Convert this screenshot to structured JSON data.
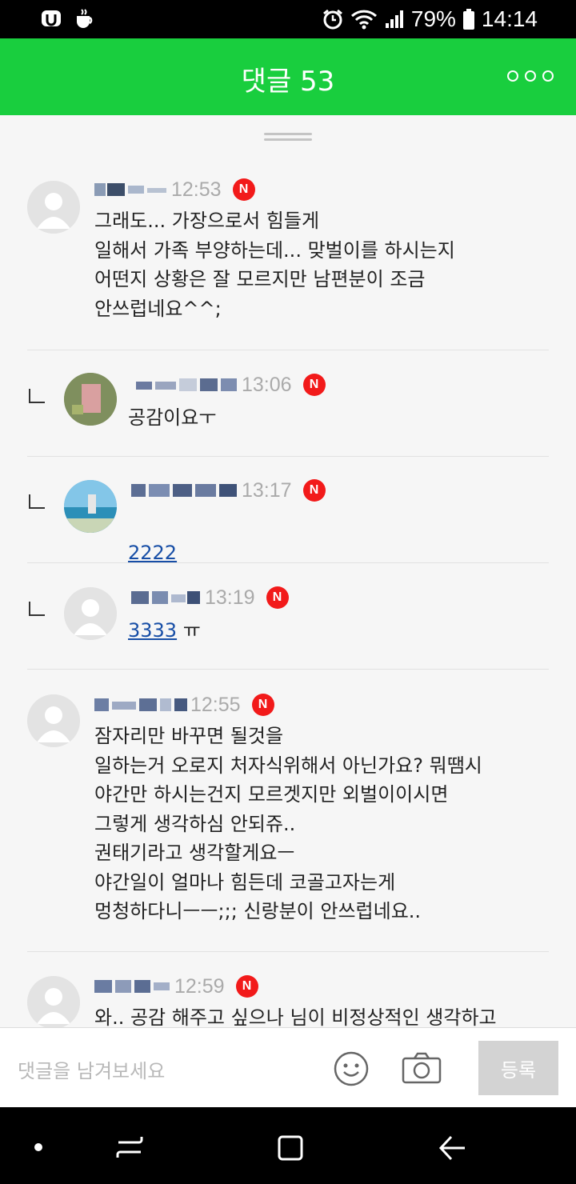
{
  "status": {
    "battery": "79%",
    "time": "14:14"
  },
  "header": {
    "title": "댓글 53"
  },
  "comments": [
    {
      "time": "12:53",
      "badge": "N",
      "text": "그래도... 가장으로서 힘들게\n일해서 가족 부양하는데... 맞벌이를 하시는지\n어떤지 상황은 잘 모르지만 남편분이 조금\n안쓰럽네요^^;"
    },
    {
      "time": "13:06",
      "badge": "N",
      "text": "공감이요ㅜ"
    },
    {
      "time": "13:17",
      "badge": "N",
      "link_text": "2222"
    },
    {
      "time": "13:19",
      "badge": "N",
      "link_text": "3333",
      "text": " ㅠ"
    },
    {
      "time": "12:55",
      "badge": "N",
      "text": "잠자리만 바꾸면 될것을\n일하는거 오로지 처자식위해서 아닌가요? 뭐땜시\n야간만 하시는건지 모르겟지만 외벌이이시면\n그렇게 생각하심 안되쥬..\n권태기라고 생각할게요ㅡ\n야간일이 얼마나 힘든데 코골고자는게\n멍청하다니ㅡㅡ;;; 신랑분이 안쓰럽네요.."
    },
    {
      "time": "12:59",
      "badge": "N",
      "text": "와.. 공감 해주고 싶으나 님이 비정상적인 생각하고"
    }
  ],
  "input": {
    "placeholder": "댓글을 남겨보세요",
    "submit_label": "등록"
  },
  "colors": {
    "header_green": "#19ce3e",
    "badge_red": "#f21a1a",
    "link_blue": "#174ea6"
  }
}
